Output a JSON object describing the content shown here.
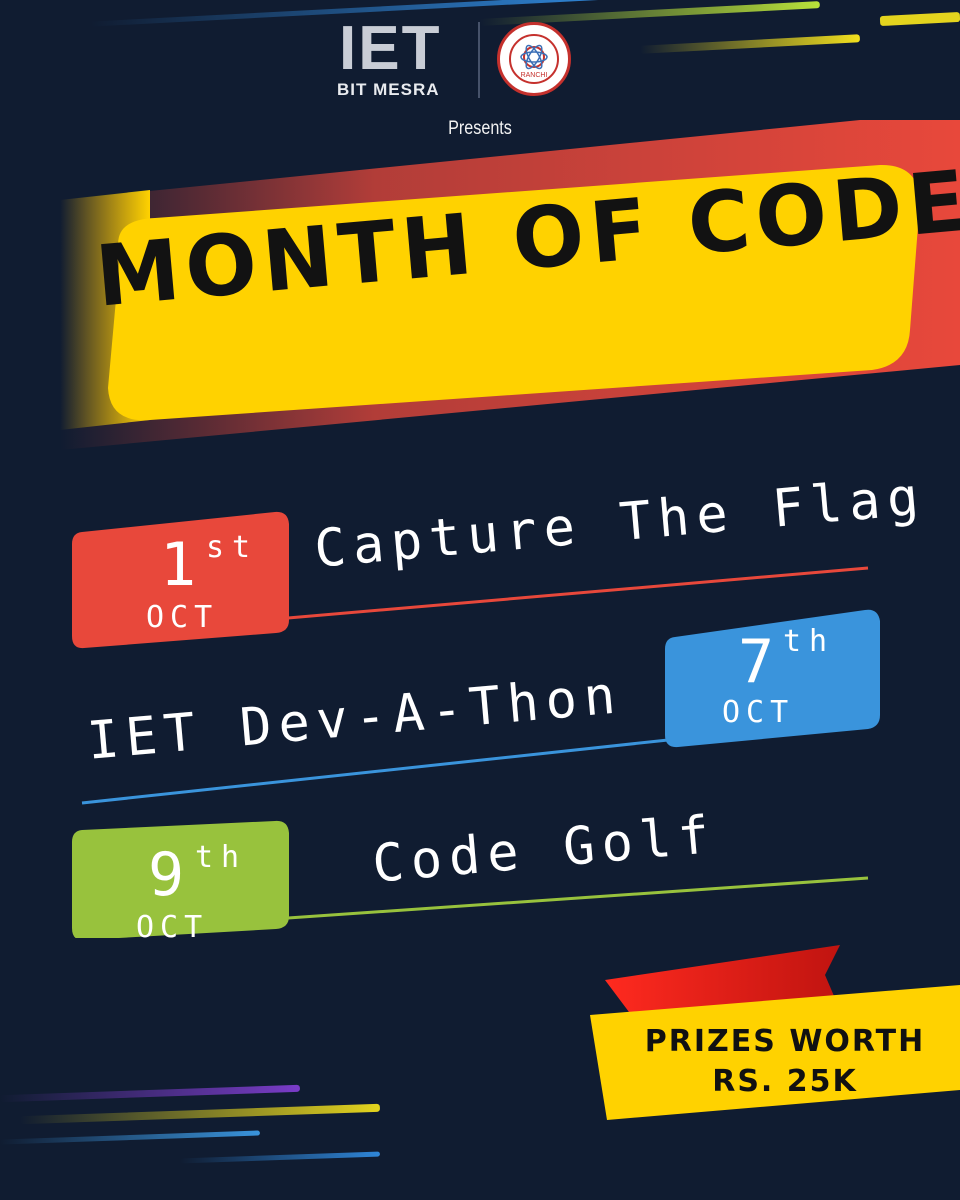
{
  "header": {
    "logo_letters": "IET",
    "logo_sub": "BIT MESRA",
    "seal_caption": "RANCHI",
    "presents": "Presents"
  },
  "title": "MONTH OF CODE",
  "events": [
    {
      "day": "1",
      "suffix": "st",
      "month": "OCT",
      "name": "Capture The Flag",
      "color": "#e8483b"
    },
    {
      "day": "7",
      "suffix": "th",
      "month": "OCT",
      "name": "IET Dev-A-Thon",
      "color": "#3a94dc"
    },
    {
      "day": "9",
      "suffix": "th",
      "month": "OCT",
      "name": "Code Golf",
      "color": "#98c23d"
    }
  ],
  "prize": {
    "line1": "PRIZES WORTH",
    "line2": "RS. 25K"
  },
  "colors": {
    "background": "#101c31",
    "banner_yellow": "#ffd200",
    "banner_red": "#e8483b",
    "flag_red": "#e0211f"
  }
}
